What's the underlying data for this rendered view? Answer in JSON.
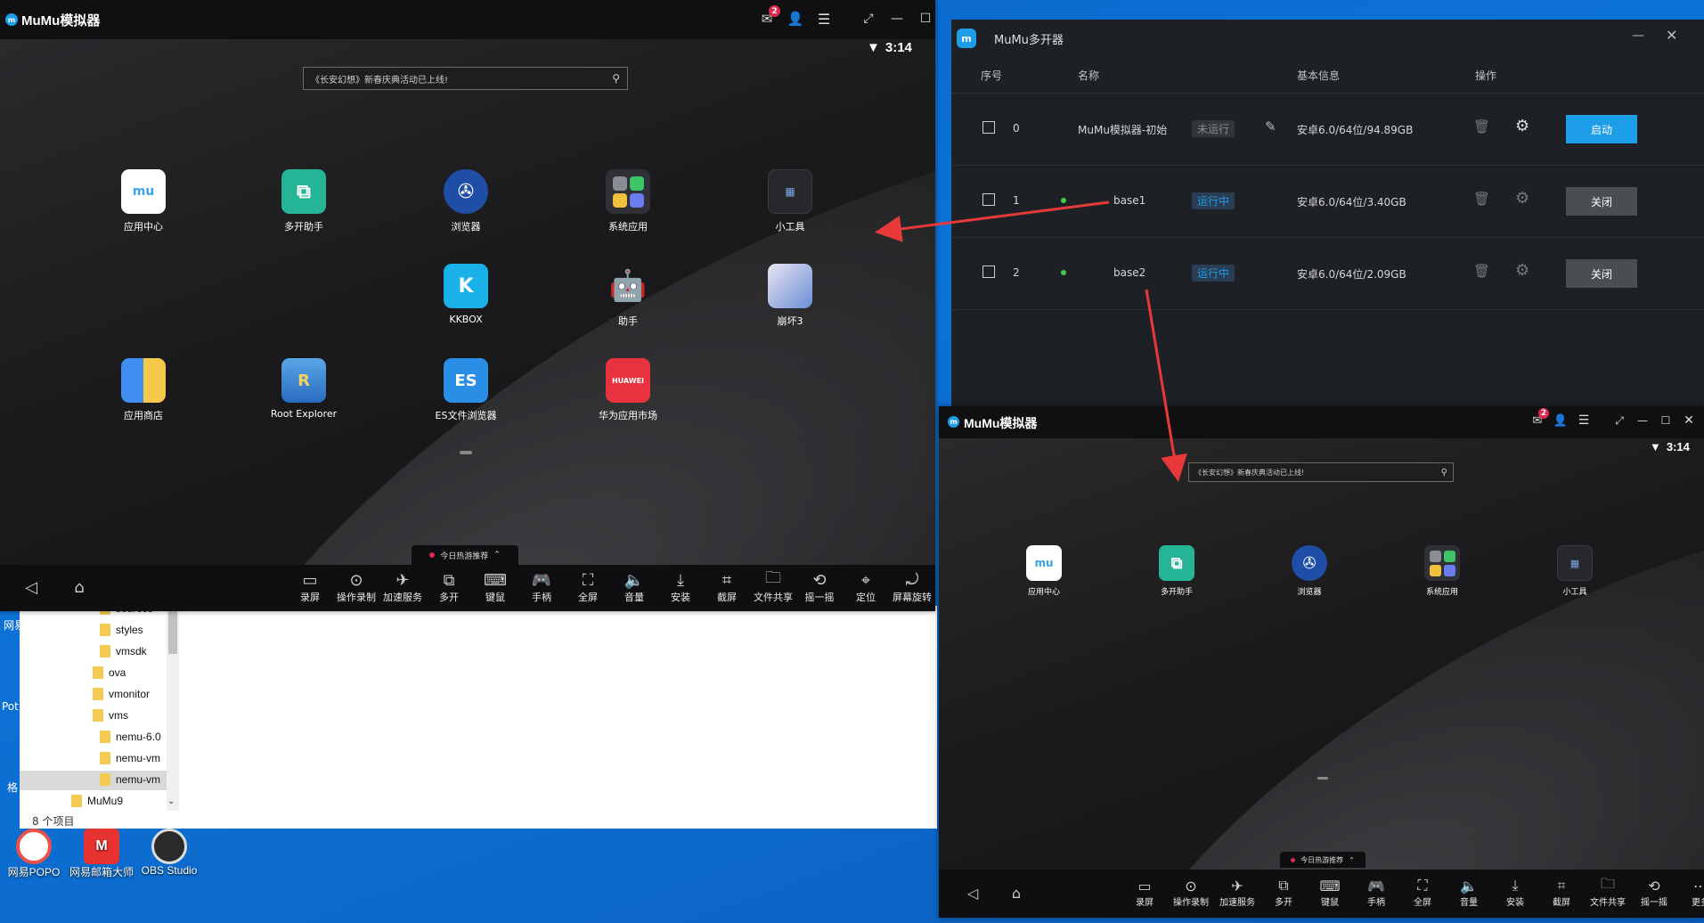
{
  "desktop": {
    "icons": [
      {
        "label": "网易POPO"
      },
      {
        "label": "网易邮箱大师"
      },
      {
        "label": "OBS Studio"
      }
    ],
    "edge_labels": [
      "网易",
      "Pot",
      "格"
    ]
  },
  "explorer": {
    "folders": [
      "sources",
      "styles",
      "vmsdk",
      "ova",
      "vmonitor",
      "vms",
      "nemu-6.0",
      "nemu-vm",
      "nemu-vm",
      "MuMu9"
    ],
    "status": "8 个项目"
  },
  "emulator_main": {
    "title": "MuMu模拟器",
    "badge_count": "2",
    "time": "3:14",
    "search_placeholder": "《长安幻想》新春庆典活动已上线!",
    "apps_row1": [
      "应用中心",
      "多开助手",
      "浏览器",
      "系统应用",
      "小工具"
    ],
    "apps_row2": [
      "KKBOX",
      "助手",
      "崩坏3"
    ],
    "apps_row3": [
      "应用商店",
      "Root Explorer",
      "ES文件浏览器",
      "华为应用市场"
    ],
    "hot_label": "今日热游推荐",
    "tools": [
      "录屏",
      "操作录制",
      "加速服务",
      "多开",
      "键鼠",
      "手柄",
      "全屏",
      "音量",
      "安装",
      "截屏",
      "文件共享",
      "摇一摇",
      "定位",
      "屏幕旋转"
    ]
  },
  "multi_manager": {
    "title": "MuMu多开器",
    "columns": [
      "序号",
      "名称",
      "基本信息",
      "操作"
    ],
    "rows": [
      {
        "index": "0",
        "name": "MuMu模拟器-初始",
        "state": "未运行",
        "info": "安卓6.0/64位/94.89GB",
        "action": "启动"
      },
      {
        "index": "1",
        "name": "base1",
        "state": "运行中",
        "info": "安卓6.0/64位/3.40GB",
        "action": "关闭"
      },
      {
        "index": "2",
        "name": "base2",
        "state": "运行中",
        "info": "安卓6.0/64位/2.09GB",
        "action": "关闭"
      }
    ]
  },
  "emulator_second": {
    "title": "MuMu模拟器",
    "badge_count": "2",
    "time": "3:14",
    "search_placeholder": "《长安幻想》新春庆典活动已上线!",
    "apps": [
      "应用中心",
      "多开助手",
      "浏览器",
      "系统应用",
      "小工具"
    ],
    "hot_label": "今日热游推荐",
    "tools": [
      "录屏",
      "操作录制",
      "加速服务",
      "多开",
      "键鼠",
      "手柄",
      "全屏",
      "音量",
      "安装",
      "截屏",
      "文件共享",
      "摇一摇",
      "更多"
    ]
  },
  "colors": {
    "accent": "#1c9de8",
    "arrow": "#e8393a",
    "badge": "#e0294f"
  }
}
